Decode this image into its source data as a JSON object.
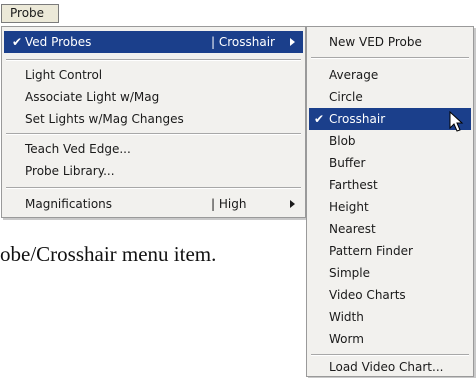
{
  "menubar": {
    "title": "Probe"
  },
  "menu": {
    "ved_probes": {
      "check": "✔",
      "label": "Ved Probes",
      "value": "Crosshair"
    },
    "light_control": {
      "label": "Light Control"
    },
    "associate_light": {
      "label": "Associate Light w/Mag"
    },
    "set_lights": {
      "label": "Set Lights w/Mag Changes"
    },
    "teach_ved_edge": {
      "label": "Teach Ved Edge..."
    },
    "probe_library": {
      "label": "Probe Library..."
    },
    "magnifications": {
      "label": "Magnifications",
      "value": "High"
    }
  },
  "submenu": {
    "new_probe": "New VED Probe",
    "items": [
      "Average",
      "Circle",
      "Crosshair",
      "Blob",
      "Buffer",
      "Farthest",
      "Height",
      "Nearest",
      "Pattern Finder",
      "Simple",
      "Video Charts",
      "Width",
      "Worm"
    ],
    "selected_check": "✔",
    "load_chart": "Load Video Chart..."
  },
  "caption": "obe/Crosshair menu item.",
  "colors": {
    "highlight": "#1b3f8b",
    "menu_bg": "#f2f1ee"
  },
  "icons": {
    "checkmark": "check-icon",
    "arrow": "submenu-arrow-icon",
    "cursor": "mouse-pointer-icon"
  }
}
